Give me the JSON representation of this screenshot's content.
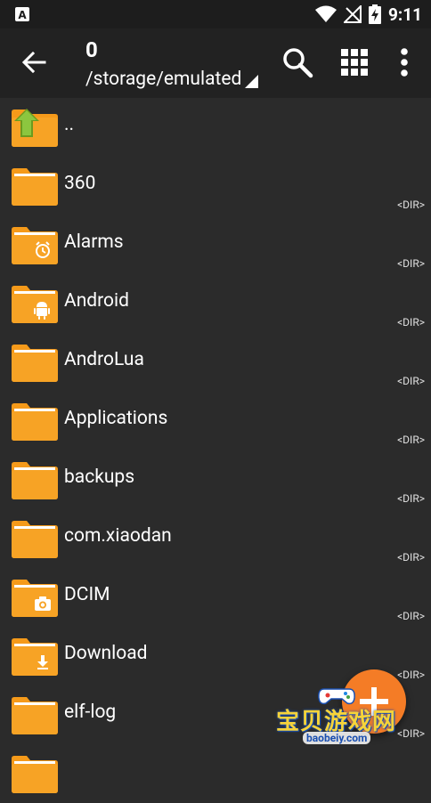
{
  "status_bar": {
    "time": "9:11"
  },
  "toolbar": {
    "count": "0",
    "path": "/storage/emulated"
  },
  "files": [
    {
      "name": "..",
      "type": "",
      "icon": "folder-up-icon"
    },
    {
      "name": "360",
      "type": "<DIR>",
      "icon": "folder-icon"
    },
    {
      "name": "Alarms",
      "type": "<DIR>",
      "icon": "folder-alarm-icon"
    },
    {
      "name": "Android",
      "type": "<DIR>",
      "icon": "folder-android-icon"
    },
    {
      "name": "AndroLua",
      "type": "<DIR>",
      "icon": "folder-icon"
    },
    {
      "name": "Applications",
      "type": "<DIR>",
      "icon": "folder-icon"
    },
    {
      "name": "backups",
      "type": "<DIR>",
      "icon": "folder-icon"
    },
    {
      "name": "com.xiaodan",
      "type": "<DIR>",
      "icon": "folder-icon"
    },
    {
      "name": "DCIM",
      "type": "<DIR>",
      "icon": "folder-camera-icon"
    },
    {
      "name": "Download",
      "type": "<DIR>",
      "icon": "folder-download-icon"
    },
    {
      "name": "elf-log",
      "type": "<DIR>",
      "icon": "folder-icon"
    }
  ],
  "watermark": {
    "text": "宝贝游戏网",
    "url": "baobeiy.com"
  },
  "colors": {
    "folder": "#f7a325",
    "folder_tab": "#f59a1a",
    "fab": "#f47c26",
    "toolbar": "#222222",
    "background": "#2b2b2b"
  }
}
